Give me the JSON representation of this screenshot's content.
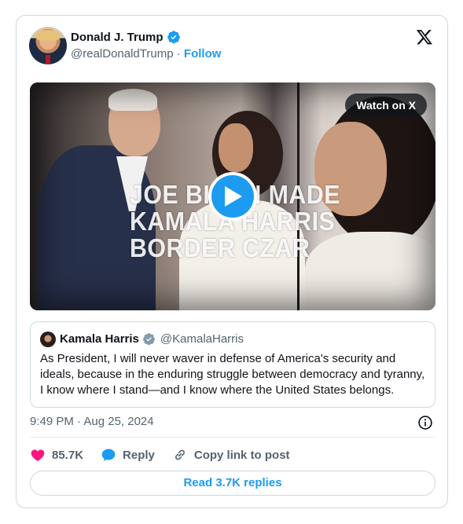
{
  "author": {
    "name": "Donald J. Trump",
    "handle": "@realDonaldTrump",
    "separator": " · ",
    "follow_label": "Follow"
  },
  "video": {
    "watch_label": "Watch on X",
    "overlay_lines": [
      "JOE BIDEN MADE",
      "KAMALA HARRIS",
      "BORDER CZAR"
    ]
  },
  "quote": {
    "name": "Kamala Harris",
    "handle": "@KamalaHarris",
    "text": "As President, I will never waver in defense of America's security and ideals, because in the enduring struggle between democracy and tyranny, I know where I stand—and I know where the United States belongs."
  },
  "timestamp": "9:49 PM · Aug 25, 2024",
  "actions": {
    "likes": "85.7K",
    "reply_label": "Reply",
    "copy_label": "Copy link to post"
  },
  "read_replies_label": "Read 3.7K replies",
  "colors": {
    "accent": "#1d9bf0",
    "like": "#f91880",
    "text_secondary": "#536471",
    "border": "#cfd9de"
  },
  "icons": [
    "verified-badge-icon",
    "x-logo-icon",
    "play-icon",
    "info-icon",
    "heart-icon",
    "reply-icon",
    "link-icon"
  ]
}
